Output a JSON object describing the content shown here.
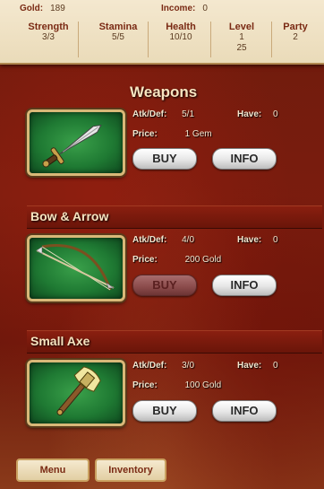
{
  "stats": {
    "gold_label": "Gold:",
    "gold_value": "189",
    "income_label": "Income:",
    "income_value": "0",
    "columns": [
      {
        "label": "Strength",
        "value": "3/3"
      },
      {
        "label": "Stamina",
        "value": "5/5"
      },
      {
        "label": "Health",
        "value": "10/10"
      },
      {
        "label": "Level",
        "value": "1",
        "sub": "25"
      },
      {
        "label": "Party",
        "value": "2"
      }
    ]
  },
  "section_title": "Weapons",
  "items": [
    {
      "name": "",
      "icon": "dagger-icon",
      "atk_label": "Atk/Def:",
      "atk_value": "5/1",
      "have_label": "Have:",
      "have_value": "0",
      "price_label": "Price:",
      "price_value": "1 Gem",
      "buy_label": "BUY",
      "info_label": "INFO",
      "buy_enabled": true
    },
    {
      "name": "Bow & Arrow",
      "icon": "bow-arrow-icon",
      "atk_label": "Atk/Def:",
      "atk_value": "4/0",
      "have_label": "Have:",
      "have_value": "0",
      "price_label": "Price:",
      "price_value": "200 Gold",
      "buy_label": "BUY",
      "info_label": "INFO",
      "buy_enabled": false
    },
    {
      "name": "Small Axe",
      "icon": "axe-icon",
      "atk_label": "Atk/Def:",
      "atk_value": "3/0",
      "have_label": "Have:",
      "have_value": "0",
      "price_label": "Price:",
      "price_value": "100 Gold",
      "buy_label": "BUY",
      "info_label": "INFO",
      "buy_enabled": true
    }
  ],
  "footer": {
    "menu_label": "Menu",
    "inventory_label": "Inventory"
  }
}
